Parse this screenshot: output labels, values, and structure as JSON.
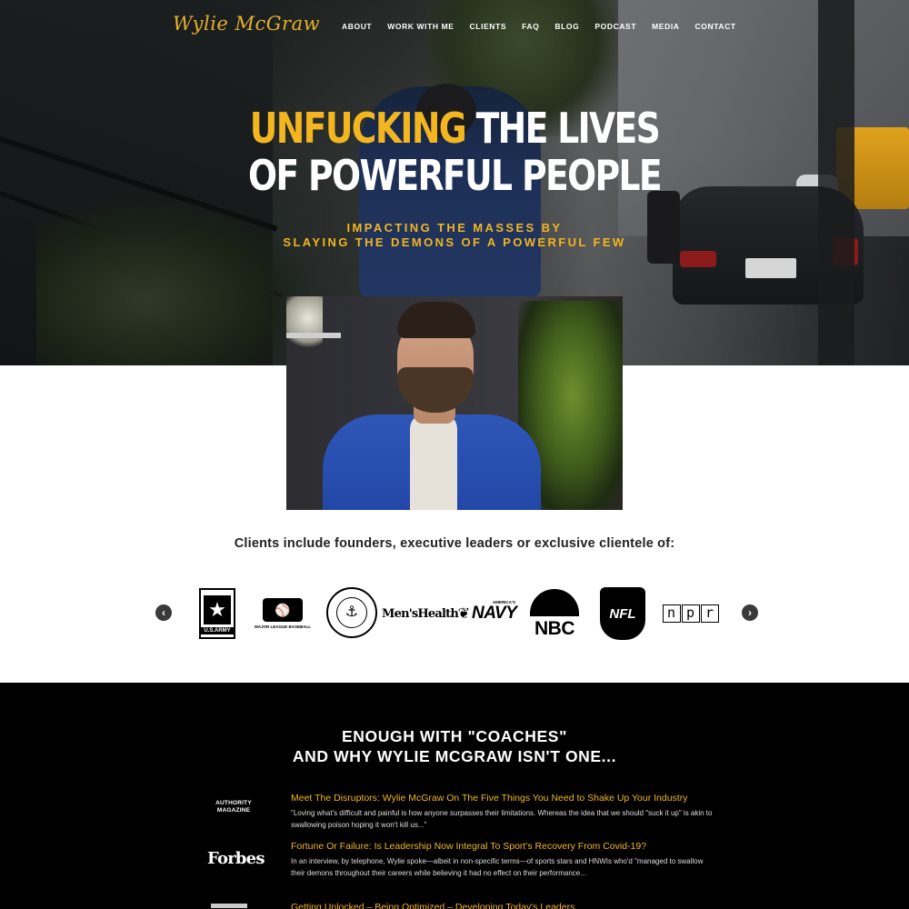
{
  "header": {
    "logo_text": "Wylie McGraw",
    "nav": [
      "ABOUT",
      "WORK WITH ME",
      "CLIENTS",
      "FAQ",
      "BLOG",
      "PODCAST",
      "MEDIA",
      "CONTACT"
    ]
  },
  "hero": {
    "headline_accent": "UNFUCKING",
    "headline_rest": " THE LIVES",
    "headline_line2": "OF POWERFUL PEOPLE",
    "subline1": "IMPACTING THE MASSES BY",
    "subline2": "SLAYING THE DEMONS OF A POWERFUL FEW"
  },
  "clients": {
    "heading": "Clients include founders, executive leaders or exclusive clientele of:",
    "prev_icon": "chevron-left-icon",
    "next_icon": "chevron-right-icon",
    "logos": {
      "army": "U.S.ARMY",
      "mlb": "MAJOR LEAGUE BASEBALL",
      "usmc": "UNITED STATES MARINE CORPS",
      "menshealth": "Men'sHealth",
      "navy": "NAVY",
      "navy_sub": "AMERICA'S",
      "nbc": "NBC",
      "nfl": "NFL",
      "npr": [
        "n",
        "p",
        "r"
      ]
    }
  },
  "press": {
    "heading_line1": "ENOUGH WITH \"COACHES\"",
    "heading_line2": "AND WHY WYLIE MCGRAW ISN'T ONE...",
    "articles": [
      {
        "publication": "AUTHORITY MAGAZINE",
        "title": "Meet The Disruptors: Wylie McGraw On The Five Things You Need to Shake Up Your Industry",
        "excerpt": "\"Loving what's difficult and painful is how anyone surpasses their limitations. Whereas the idea that we should \"suck it up\" is akin to swallowing poison hoping it won't kill us...\""
      },
      {
        "publication": "Forbes",
        "title": "Fortune Or Failure: Is Leadership Now Integral To Sport's Recovery From Covid-19?",
        "excerpt": "In an interview, by telephone, Wylie spoke—albeit in non-specific terms—of sports stars and HNWIs who'd \"managed to swallow their demons throughout their careers while believing it had no effect on their performance..."
      },
      {
        "publication": "",
        "title": "Getting Unlocked – Being Optimized – Developing Today's Leaders",
        "excerpt": ""
      }
    ]
  },
  "colors": {
    "accent": "#f3b61f",
    "black": "#000000",
    "white": "#ffffff"
  }
}
